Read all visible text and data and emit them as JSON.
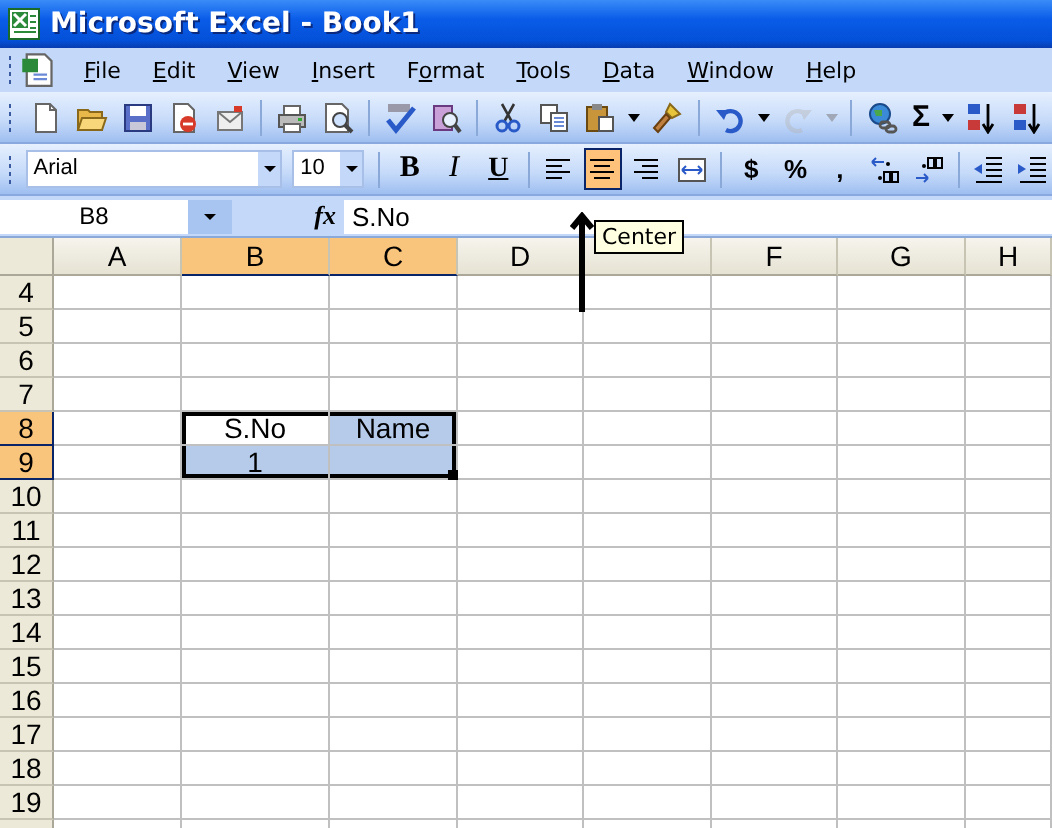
{
  "window": {
    "title": "Microsoft Excel - Book1"
  },
  "menu": [
    {
      "key": "F",
      "rest": "ile"
    },
    {
      "key": "E",
      "rest": "dit"
    },
    {
      "key": "V",
      "rest": "iew"
    },
    {
      "key": "I",
      "rest": "nsert"
    },
    {
      "lead": "F",
      "key": "o",
      "rest": "rmat"
    },
    {
      "key": "T",
      "rest": "ools"
    },
    {
      "key": "D",
      "rest": "ata"
    },
    {
      "key": "W",
      "rest": "indow"
    },
    {
      "key": "H",
      "rest": "elp"
    }
  ],
  "standard_toolbar": [
    [
      {
        "kind": "new",
        "disabled": false
      },
      {
        "kind": "open",
        "disabled": false
      },
      {
        "kind": "save",
        "disabled": false
      },
      {
        "kind": "permission",
        "disabled": false
      },
      {
        "kind": "email",
        "disabled": false
      }
    ],
    [
      {
        "kind": "print",
        "disabled": false
      },
      {
        "kind": "preview",
        "disabled": false
      }
    ],
    [
      {
        "kind": "spelling",
        "disabled": false
      },
      {
        "kind": "research",
        "disabled": false
      }
    ],
    [
      {
        "kind": "cut",
        "disabled": false
      },
      {
        "kind": "copy",
        "disabled": false
      },
      {
        "kind": "paste",
        "disabled": false
      },
      {
        "kind": "dropdown",
        "disabled": false
      },
      {
        "kind": "painter",
        "disabled": false
      }
    ],
    [
      {
        "kind": "undo",
        "disabled": false
      },
      {
        "kind": "dropdown",
        "disabled": false
      },
      {
        "kind": "redo",
        "disabled": true
      },
      {
        "kind": "dropdown",
        "disabled": true
      }
    ],
    [
      {
        "kind": "hyperlink",
        "disabled": false
      },
      {
        "kind": "symbol",
        "label": "Σ",
        "disabled": false
      },
      {
        "kind": "dropdown",
        "disabled": false
      },
      {
        "kind": "sort-asc",
        "disabled": false
      },
      {
        "kind": "sort-desc",
        "disabled": false
      }
    ]
  ],
  "formatting_toolbar": {
    "font": "Arial",
    "size": "10",
    "button_groups": [
      [
        {
          "kind": "bold",
          "label": "B",
          "selected": false
        },
        {
          "kind": "italic",
          "label": "I",
          "selected": false
        },
        {
          "kind": "underline",
          "label": "U",
          "selected": false
        }
      ],
      [
        {
          "kind": "align-left",
          "selected": false
        },
        {
          "kind": "align-center",
          "selected": true
        },
        {
          "kind": "align-right",
          "selected": false
        },
        {
          "kind": "merge",
          "selected": false
        }
      ],
      [
        {
          "kind": "text",
          "label": "$",
          "selected": false
        },
        {
          "kind": "text",
          "label": "%",
          "selected": false
        },
        {
          "kind": "text",
          "label": ",",
          "selected": false
        },
        {
          "kind": "inc-decimal",
          "selected": false
        },
        {
          "kind": "dec-decimal",
          "selected": false
        }
      ],
      [
        {
          "kind": "dec-indent",
          "selected": false
        },
        {
          "kind": "inc-indent",
          "selected": false
        }
      ]
    ]
  },
  "name_box": "B8",
  "function_label": "fx",
  "formula": "S.No",
  "tooltip": "Center",
  "columns": [
    {
      "label": "A",
      "selected": false
    },
    {
      "label": "B",
      "selected": true
    },
    {
      "label": "C",
      "selected": true
    },
    {
      "label": "D",
      "selected": false
    },
    {
      "selected": false
    },
    {
      "label": "F",
      "selected": false
    },
    {
      "label": "G",
      "selected": false
    },
    {
      "label": "H",
      "selected": false
    }
  ],
  "rows": [
    {
      "label": "4",
      "selected": false
    },
    {
      "label": "5",
      "selected": false
    },
    {
      "label": "6",
      "selected": false
    },
    {
      "label": "7",
      "selected": false
    },
    {
      "label": "8",
      "selected": true,
      "cells": [
        {
          "selected": false,
          "active": false
        },
        {
          "text": "S.No",
          "selected": true,
          "active": true
        },
        {
          "text": "Name",
          "selected": true,
          "active": false
        },
        {
          "selected": false,
          "active": false
        },
        {
          "selected": false,
          "active": false
        },
        {
          "selected": false,
          "active": false
        },
        {
          "selected": false,
          "active": false
        },
        {
          "selected": false,
          "active": false
        }
      ]
    },
    {
      "label": "9",
      "selected": true,
      "cells": [
        {
          "selected": false,
          "active": false
        },
        {
          "text": "1",
          "selected": true,
          "active": false
        },
        {
          "selected": true,
          "active": false
        },
        {
          "selected": false,
          "active": false
        },
        {
          "selected": false,
          "active": false
        },
        {
          "selected": false,
          "active": false
        },
        {
          "selected": false,
          "active": false
        },
        {
          "selected": false,
          "active": false
        }
      ]
    },
    {
      "label": "10",
      "selected": false
    },
    {
      "label": "11",
      "selected": false
    },
    {
      "label": "12",
      "selected": false
    },
    {
      "label": "13",
      "selected": false
    },
    {
      "label": "14",
      "selected": false
    },
    {
      "label": "15",
      "selected": false
    },
    {
      "label": "16",
      "selected": false
    },
    {
      "label": "17",
      "selected": false
    },
    {
      "label": "18",
      "selected": false
    },
    {
      "label": "19",
      "selected": false
    },
    {
      "selected": false
    }
  ]
}
